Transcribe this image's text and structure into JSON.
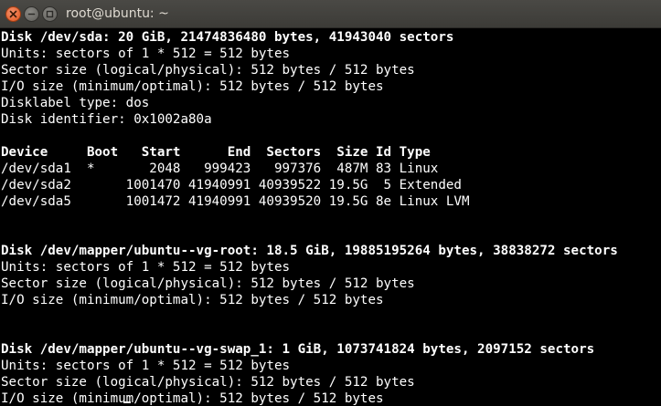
{
  "window": {
    "title": "root@ubuntu: ~"
  },
  "terminal": {
    "lines": [
      {
        "text": "Disk /dev/sda: 20 GiB, 21474836480 bytes, 41943040 sectors",
        "bold": true
      },
      {
        "text": "Units: sectors of 1 * 512 = 512 bytes",
        "bold": false
      },
      {
        "text": "Sector size (logical/physical): 512 bytes / 512 bytes",
        "bold": false
      },
      {
        "text": "I/O size (minimum/optimal): 512 bytes / 512 bytes",
        "bold": false
      },
      {
        "text": "Disklabel type: dos",
        "bold": false
      },
      {
        "text": "Disk identifier: 0x1002a80a",
        "bold": false
      },
      {
        "text": "",
        "bold": false
      },
      {
        "text": "Device     Boot   Start      End  Sectors  Size Id Type",
        "bold": true
      },
      {
        "text": "/dev/sda1  *       2048   999423   997376  487M 83 Linux",
        "bold": false
      },
      {
        "text": "/dev/sda2       1001470 41940991 40939522 19.5G  5 Extended",
        "bold": false
      },
      {
        "text": "/dev/sda5       1001472 41940991 40939520 19.5G 8e Linux LVM",
        "bold": false
      },
      {
        "text": "",
        "bold": false
      },
      {
        "text": "",
        "bold": false
      },
      {
        "text": "Disk /dev/mapper/ubuntu--vg-root: 18.5 GiB, 19885195264 bytes, 38838272 sectors",
        "bold": true
      },
      {
        "text": "Units: sectors of 1 * 512 = 512 bytes",
        "bold": false
      },
      {
        "text": "Sector size (logical/physical): 512 bytes / 512 bytes",
        "bold": false
      },
      {
        "text": "I/O size (minimum/optimal): 512 bytes / 512 bytes",
        "bold": false
      },
      {
        "text": "",
        "bold": false
      },
      {
        "text": "",
        "bold": false
      },
      {
        "text": "Disk /dev/mapper/ubuntu--vg-swap_1: 1 GiB, 1073741824 bytes, 2097152 sectors",
        "bold": true
      },
      {
        "text": "Units: sectors of 1 * 512 = 512 bytes",
        "bold": false
      },
      {
        "text": "Sector size (logical/physical): 512 bytes / 512 bytes",
        "bold": false
      },
      {
        "text": "I/O size (minimum/optimal): 512 bytes / 512 bytes",
        "bold": false
      }
    ]
  },
  "icons": {
    "close": "close-icon",
    "minimize": "minimize-icon",
    "maximize": "maximize-icon"
  },
  "colors": {
    "titlebar": "#3c3b37",
    "close_button": "#e0561e",
    "terminal_bg": "#000000",
    "terminal_fg": "#ffffff"
  }
}
